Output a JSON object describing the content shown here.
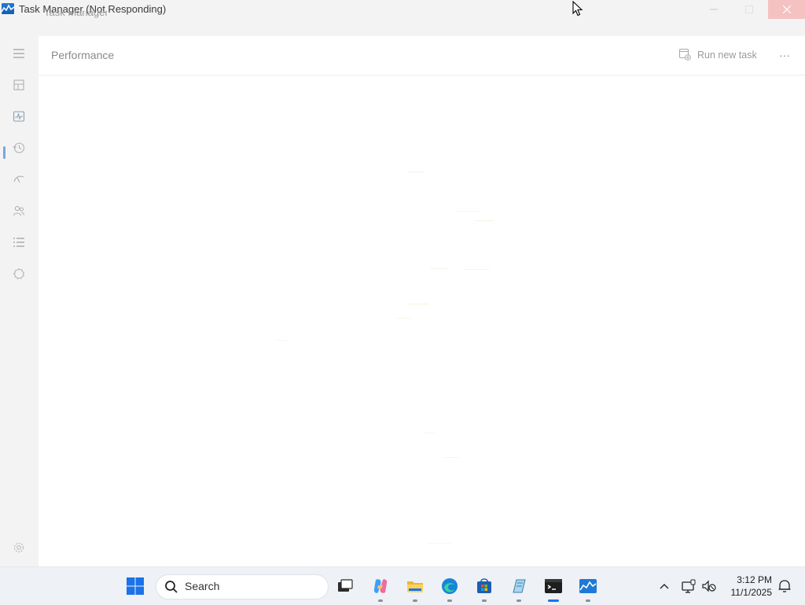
{
  "window": {
    "title": "Task Manager (Not Responding)",
    "ghost_title": "Task Manager"
  },
  "main": {
    "page_title": "Performance",
    "run_new_task_label": "Run new task",
    "more_label": "···"
  },
  "nav": {
    "items": [
      "menu",
      "processes",
      "performance",
      "app-history",
      "startup-apps",
      "users",
      "details",
      "services"
    ],
    "active": "performance",
    "settings": "settings"
  },
  "taskbar": {
    "search_label": "Search",
    "time": "3:12 PM",
    "date": "11/1/2025",
    "pinned": [
      "start",
      "task-view",
      "copilot",
      "file-explorer",
      "edge",
      "microsoft-store",
      "notepad",
      "terminal",
      "task-manager"
    ],
    "active_app": "terminal"
  },
  "colors": {
    "accent": "#0078d4",
    "close_hover": "#f5c1c1",
    "nav_background": "#f3f3f3"
  }
}
